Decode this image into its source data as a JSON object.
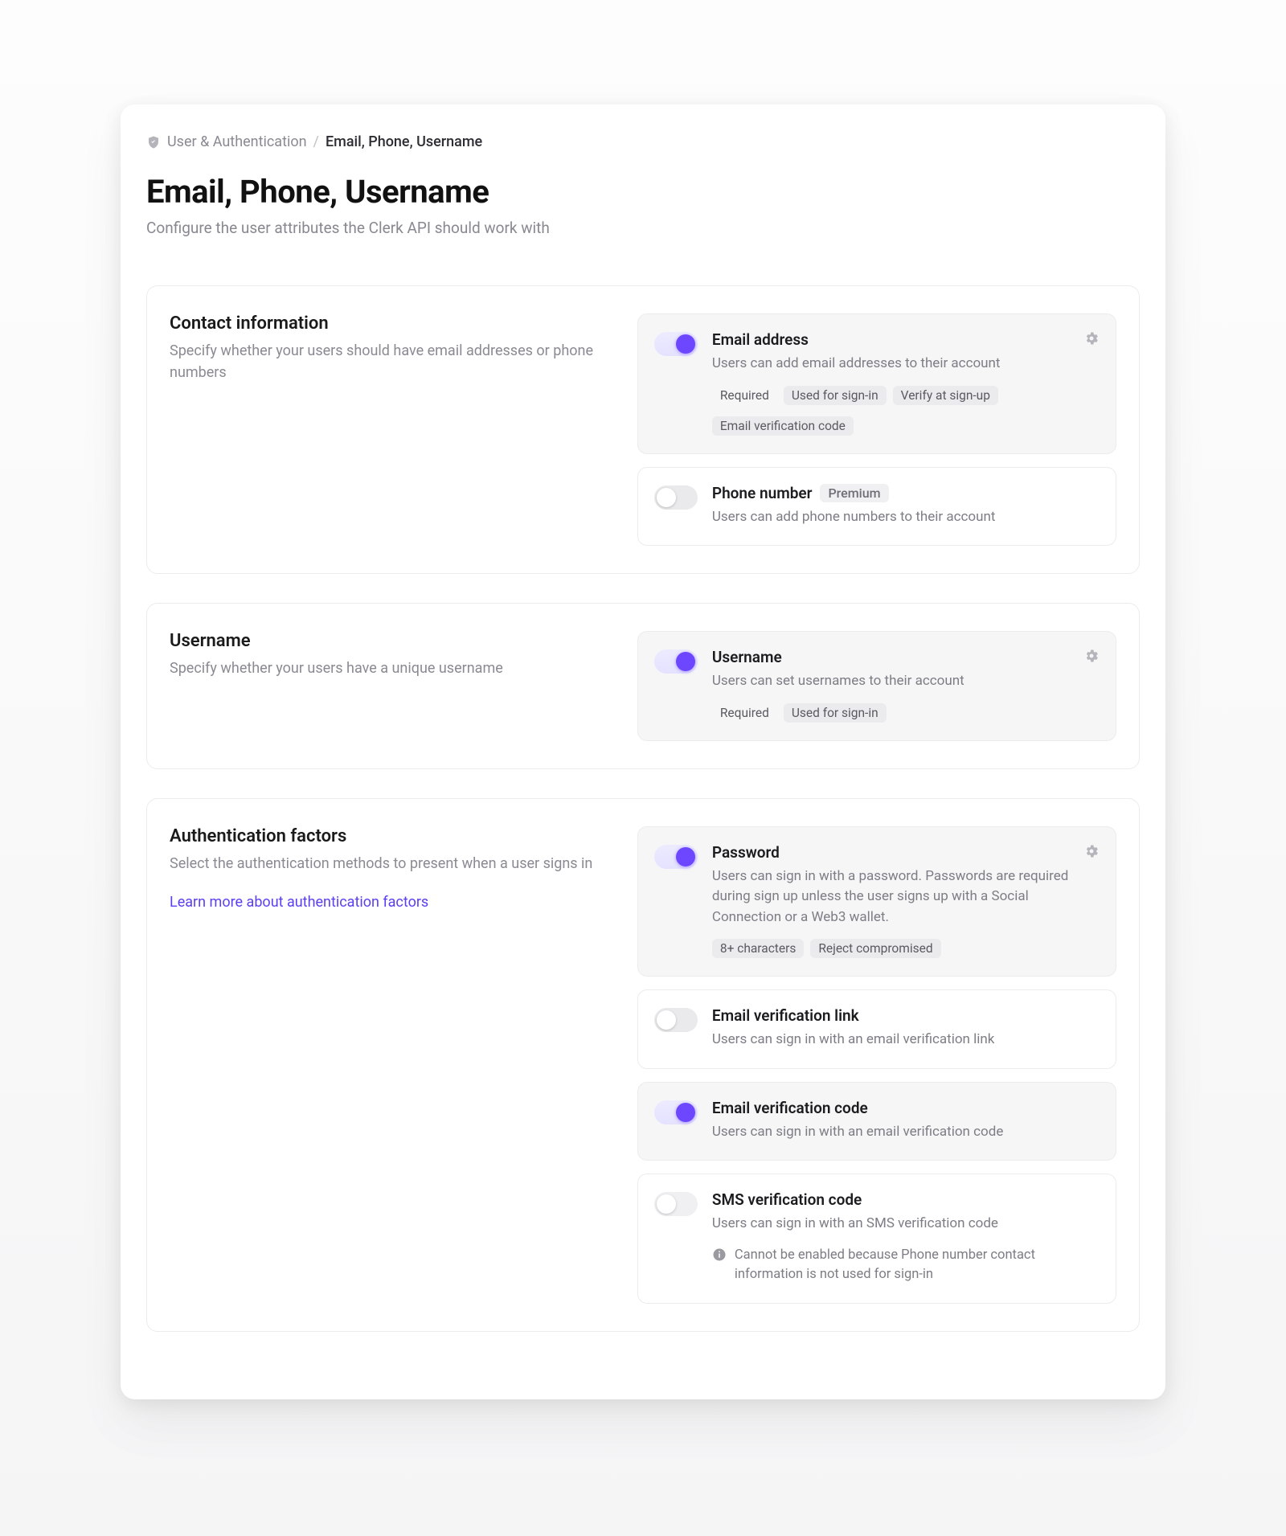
{
  "breadcrumb": {
    "parent": "User & Authentication",
    "separator": "/",
    "current": "Email, Phone, Username"
  },
  "page": {
    "title": "Email, Phone, Username",
    "subtitle": "Configure the user attributes the Clerk API should work with"
  },
  "sections": {
    "contact": {
      "title": "Contact information",
      "description": "Specify whether your users should have email addresses or phone numbers"
    },
    "username": {
      "title": "Username",
      "description": "Specify whether your users have a unique username"
    },
    "auth": {
      "title": "Authentication factors",
      "description": "Select the authentication methods to present when a user signs in",
      "learn_more": "Learn more about authentication factors"
    }
  },
  "options": {
    "email": {
      "title": "Email address",
      "desc": "Users can add email addresses to their account",
      "tag_required": "Required",
      "tag_signin": "Used for sign-in",
      "tag_verify": "Verify at sign-up",
      "tag_code": "Email verification code"
    },
    "phone": {
      "title": "Phone number",
      "premium": "Premium",
      "desc": "Users can add phone numbers to their account"
    },
    "username": {
      "title": "Username",
      "desc": "Users can set usernames to their account",
      "tag_required": "Required",
      "tag_signin": "Used for sign-in"
    },
    "password": {
      "title": "Password",
      "desc": "Users can sign in with a password. Passwords are required during sign up unless the user signs up with a Social Connection or a Web3 wallet.",
      "tag_len": "8+ characters",
      "tag_reject": "Reject compromised"
    },
    "email_link": {
      "title": "Email verification link",
      "desc": "Users can sign in with an email verification link"
    },
    "email_code": {
      "title": "Email verification code",
      "desc": "Users can sign in with an email verification code"
    },
    "sms": {
      "title": "SMS verification code",
      "desc": "Users can sign in with an SMS verification code",
      "warning": "Cannot be enabled because Phone number contact information is not used for sign-in"
    }
  }
}
